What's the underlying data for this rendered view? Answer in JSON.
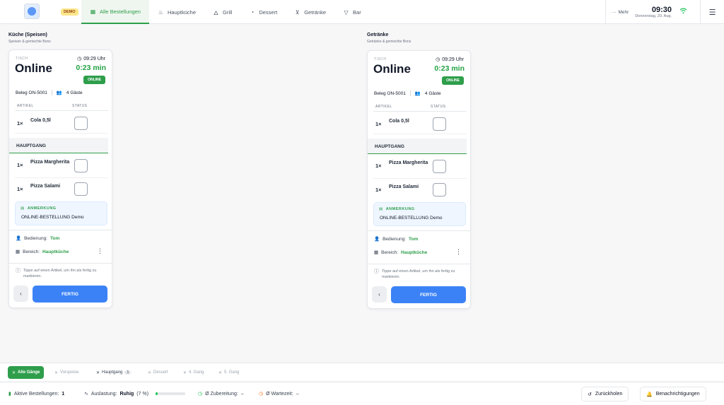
{
  "header": {
    "demo_badge": "DEMO",
    "tabs": [
      {
        "label": "Alle Bestellungen",
        "icon": "grid-icon",
        "active": true
      },
      {
        "label": "Hauptküche",
        "icon": "chef-hat-icon",
        "active": false
      },
      {
        "label": "Grill",
        "icon": "flame-icon",
        "active": false
      },
      {
        "label": "Dessert",
        "icon": "dessert-icon",
        "active": false
      },
      {
        "label": "Getränke",
        "icon": "drink-icon",
        "active": false
      },
      {
        "label": "Bar",
        "icon": "cocktail-icon",
        "active": false
      }
    ],
    "more_label": "Mehr",
    "time": "09:30",
    "date": "Donnerstag, 20. Aug."
  },
  "columns": [
    {
      "title": "Küche (Speisen)",
      "subtitle": "Speisen & gemischte Bons",
      "card": {
        "tisch_label": "TISCH",
        "tisch": "Online",
        "order_time": "09:29 Uhr",
        "elapsed": "0:23 min",
        "badge": "ONLINE",
        "beleg": "Beleg ON-5001",
        "guests": "4 Gäste",
        "col_artikel": "ARTIKEL",
        "col_status": "STATUS",
        "items_top": [
          {
            "qty": "1×",
            "name": "Cola 0,5l"
          }
        ],
        "course": "HAUPTGANG",
        "items_course": [
          {
            "qty": "1×",
            "name": "Pizza Margherita"
          },
          {
            "qty": "1×",
            "name": "Pizza Salami"
          }
        ],
        "note_label": "ANMERKUNG",
        "note_text": "ONLINE-BESTELLUNG Demo",
        "service_label": "Bedienung:",
        "service_name": "Tom",
        "area_label": "Bereich:",
        "area_name": "Hauptküche",
        "hint": "Tippe auf einen Artikel, um ihn als fertig zu markieren.",
        "back_label": "‹",
        "done_label": "FERTIG"
      }
    },
    {
      "title": "Getränke",
      "subtitle": "Getränke & gemischte Bons",
      "card": {
        "tisch_label": "TISCH",
        "tisch": "Online",
        "order_time": "09:29 Uhr",
        "elapsed": "0:23 min",
        "badge": "ONLINE",
        "beleg": "Beleg ON-5001",
        "guests": "4 Gäste",
        "col_artikel": "ARTIKEL",
        "col_status": "STATUS",
        "items_top": [
          {
            "qty": "1×",
            "name": "Cola 0,5l"
          }
        ],
        "course": "HAUPTGANG",
        "items_course": [
          {
            "qty": "1×",
            "name": "Pizza Margherita"
          },
          {
            "qty": "1×",
            "name": "Pizza Salami"
          }
        ],
        "note_label": "ANMERKUNG",
        "note_text": "ONLINE-BESTELLUNG Demo",
        "service_label": "Bedienung:",
        "service_name": "Tom",
        "area_label": "Bereich:",
        "area_name": "Hauptküche",
        "hint": "Tippe auf einen Artikel, um ihn als fertig zu markieren.",
        "back_label": "‹",
        "done_label": "FERTIG"
      }
    }
  ],
  "courses": [
    {
      "label": "Alle Gänge",
      "active": true
    },
    {
      "label": "Vorspeise"
    },
    {
      "label": "Hauptgang",
      "count": "1"
    },
    {
      "label": "Dessert"
    },
    {
      "label": "4. Gang"
    },
    {
      "label": "5. Gang"
    }
  ],
  "status": {
    "active_label": "Aktive Bestellungen:",
    "active_value": "1",
    "load_label": "Auslastung:",
    "load_value": "Ruhig",
    "load_percent_text": "(7 %)",
    "load_fraction": 0.07,
    "prep_label": "Ø Zubereitung:",
    "prep_value": "–",
    "wait_label": "Ø Wartezeit:",
    "wait_value": "–",
    "undo_label": "Zurückholen",
    "notify_label": "Benachrichtigungen"
  },
  "colors": {
    "accent": "#2e9e4b",
    "primary": "#3b82f6"
  }
}
